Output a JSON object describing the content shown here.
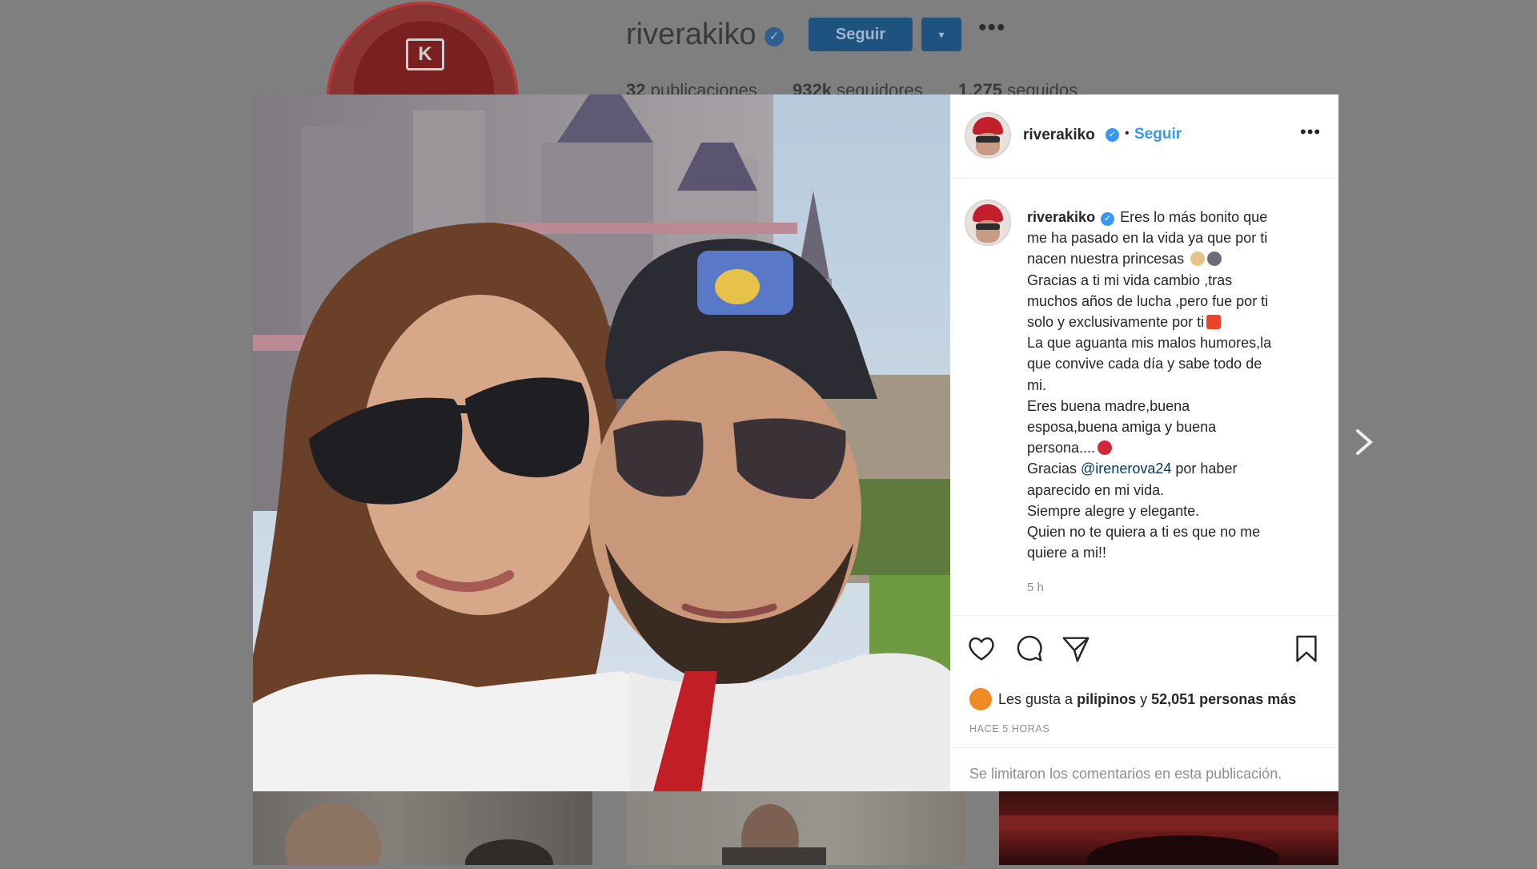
{
  "profile": {
    "username": "riverakiko",
    "follow_button": "Seguir",
    "dropdown_glyph": "▾",
    "more_glyph": "•••",
    "stats": [
      {
        "count": "32",
        "label": "publicaciones"
      },
      {
        "count": "932k",
        "label": "seguidores"
      },
      {
        "count": "1.275",
        "label": "seguidos"
      }
    ],
    "avatar_logo": "K"
  },
  "post": {
    "username": "riverakiko",
    "follow_link": "Seguir",
    "separator": "•",
    "more_glyph": "•••",
    "caption": {
      "username": "riverakiko",
      "lines": [
        "Eres lo más bonito que",
        "me ha pasado en la vida ya que por ti",
        "nacen nuestra princesas",
        "Gracias a ti mi vida cambio ,tras",
        "muchos años de lucha ,pero fue por ti",
        "solo y exclusivamente por ti",
        "La que aguanta mis malos humores,la",
        "que convive cada día y sabe todo de",
        "mi.",
        "Eres buena madre,buena",
        "esposa,buena amiga y buena",
        "persona....",
        "Gracias",
        "@irenerova24",
        "por haber",
        "aparecido en mi vida.",
        "Siempre alegre y elegante.",
        "Quien no te quiera a ti es que no me",
        "quiere a mi!!"
      ],
      "time": "5 h"
    },
    "likes": {
      "prefix": "Les gusta a",
      "user": "pilipinos",
      "joiner": "y",
      "count_text": "52,051 personas más"
    },
    "posted_ago": "HACE 5 HORAS",
    "comments_limited": "Se limitaron los comentarios en esta publicación.",
    "icons": [
      "heart-icon",
      "comment-icon",
      "share-icon",
      "bookmark-icon",
      "chevron-right-icon",
      "verified-icon"
    ]
  },
  "colors": {
    "accent": "#3897f0",
    "mention": "#00376b",
    "secondary_text": "#8e8e8e",
    "overlay_bg": "#7f7f7f"
  }
}
